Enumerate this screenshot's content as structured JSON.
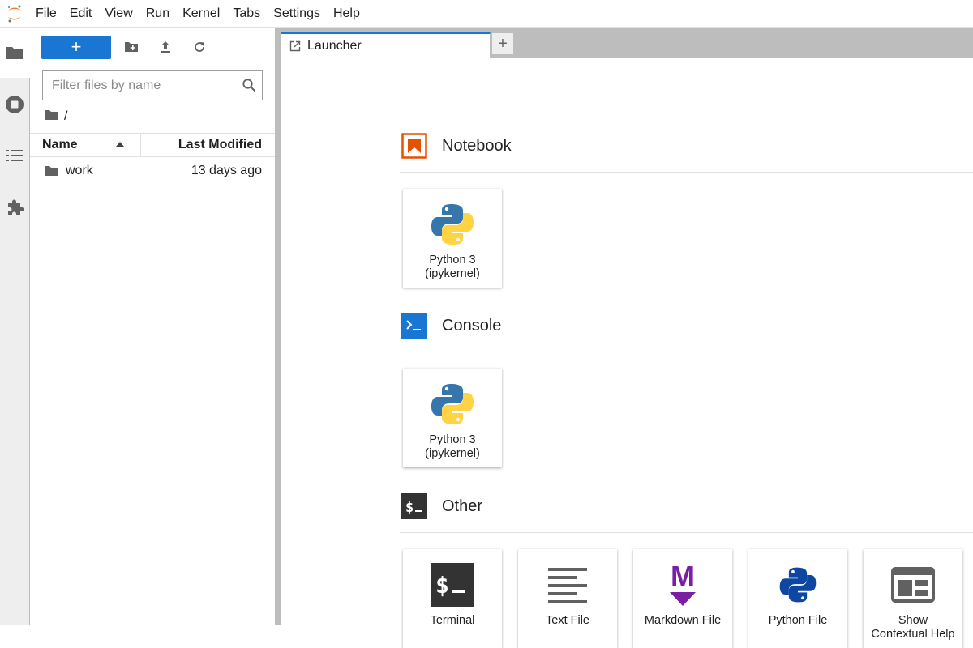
{
  "menu": {
    "items": [
      "File",
      "Edit",
      "View",
      "Run",
      "Kernel",
      "Tabs",
      "Settings",
      "Help"
    ]
  },
  "filebrowser": {
    "new_label": "+",
    "filter_placeholder": "Filter files by name",
    "breadcrumb": "/",
    "columns": {
      "name": "Name",
      "modified": "Last Modified"
    },
    "files": [
      {
        "name": "work",
        "modified": "13 days ago",
        "type": "folder"
      }
    ]
  },
  "tabs": {
    "active_label": "Launcher",
    "add_label": "+"
  },
  "launcher": {
    "sections": {
      "notebook": {
        "title": "Notebook",
        "cards": [
          {
            "label_line1": "Python 3",
            "label_line2": "(ipykernel)",
            "icon": "python-logo-icon"
          }
        ]
      },
      "console": {
        "title": "Console",
        "cards": [
          {
            "label_line1": "Python 3",
            "label_line2": "(ipykernel)",
            "icon": "python-logo-icon"
          }
        ]
      },
      "other": {
        "title": "Other",
        "cards": [
          {
            "label_line1": "Terminal",
            "label_line2": "",
            "icon": "terminal-icon"
          },
          {
            "label_line1": "Text File",
            "label_line2": "",
            "icon": "text-file-icon"
          },
          {
            "label_line1": "Markdown File",
            "label_line2": "",
            "icon": "markdown-icon"
          },
          {
            "label_line1": "Python File",
            "label_line2": "",
            "icon": "python-file-icon"
          },
          {
            "label_line1": "Show",
            "label_line2": "Contextual Help",
            "icon": "contextual-help-icon"
          }
        ]
      }
    }
  },
  "colors": {
    "accent": "#1976d2",
    "notebook_orange": "#e65100",
    "console_blue": "#1976d2",
    "other_dark": "#333333",
    "markdown_purple": "#7b1fa2"
  }
}
